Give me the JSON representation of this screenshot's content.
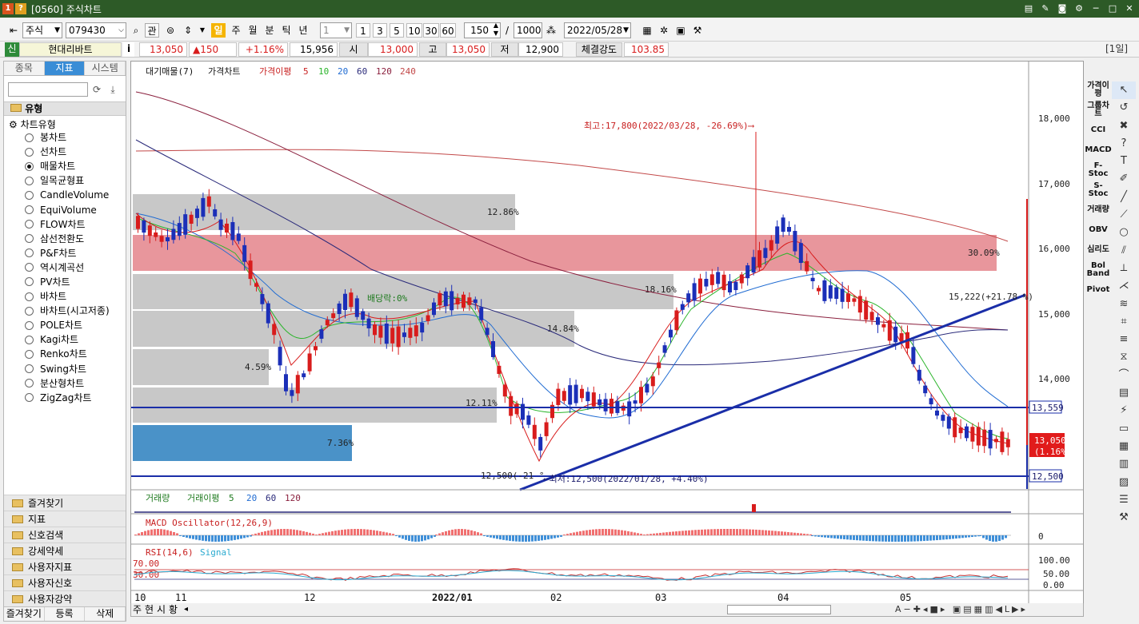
{
  "window": {
    "badge1": "1",
    "badge2": "?",
    "title": "[0560] 주식차트"
  },
  "titlebar_icons": [
    "doc-icon",
    "edit-icon",
    "camera-icon",
    "gear-icon",
    "minimize-icon",
    "maximize-icon",
    "close-icon"
  ],
  "toolbar": {
    "market": "주식",
    "code": "079430",
    "btn_gwan": "관",
    "periods": [
      "일",
      "주",
      "월",
      "분",
      "틱",
      "년"
    ],
    "interval": "1",
    "quick": [
      "1",
      "3",
      "5",
      "10",
      "30",
      "60"
    ],
    "count": "150",
    "slash": "/",
    "total": "1000",
    "date": "2022/05/28"
  },
  "quote": {
    "badge": "신",
    "name": "현대리바트",
    "info": "i",
    "price": "13,050",
    "change": "▲150",
    "change_pct": "+1.16%",
    "volume": "15,956",
    "open_label": "시",
    "open": "13,000",
    "high_label": "고",
    "high": "13,050",
    "low_label": "저",
    "low": "12,900",
    "strength_label": "체결강도",
    "strength": "103.85",
    "period_tag": "[1일]"
  },
  "left_panel": {
    "tabs": [
      "종목",
      "지표",
      "시스템"
    ],
    "active_tab": 1,
    "header": "유형",
    "tree_root": "차트유형",
    "chart_types": [
      "봉차트",
      "선차트",
      "매물차트",
      "일목균형표",
      "CandleVolume",
      "EquiVolume",
      "FLOW차트",
      "삼선전환도",
      "P&F차트",
      "역시계곡선",
      "PV차트",
      "바차트",
      "바차트(시고저종)",
      "POLE차트",
      "Kagi차트",
      "Renko차트",
      "Swing차트",
      "분산형차트",
      "ZigZag차트"
    ],
    "selected_index": 2,
    "groups": [
      "즐겨찾기",
      "지표",
      "신호검색",
      "강세약세",
      "사용자지표",
      "사용자신호",
      "사용자강약"
    ],
    "footer": [
      "즐겨찾기",
      "등록",
      "삭제"
    ]
  },
  "chart": {
    "legend_main": [
      "대기매물(7)",
      "가격차트",
      "가격이평",
      "5",
      "10",
      "20",
      "60",
      "120",
      "240"
    ],
    "legend_vol": [
      "거래량",
      "거래이평",
      "5",
      "20",
      "60",
      "120"
    ],
    "legend_macd": "MACD Oscillator(12,26,9)",
    "legend_rsi": [
      "RSI(14,6)",
      "Signal"
    ],
    "price_axis": [
      "18,000",
      "17,000",
      "16,000",
      "15,000",
      "14,000"
    ],
    "price_marks": {
      "line1": "13,559",
      "current": "13,050",
      "current_pct": "(1.16%)",
      "line2": "12,500"
    },
    "zones": [
      "12.86%",
      "30.09%",
      "18.16%",
      "14.84%",
      "4.59%",
      "12.11%",
      "7.36%"
    ],
    "annotations": {
      "high": "최고:17,800(2022/03/28, -26.69%)⟶",
      "low": "⟵최저:12,500(2022/01/28, +4.40%)",
      "low_left": "12,500(-21 °",
      "dividend": "배당락:0%",
      "trend": "15,222(+21.78 %)"
    },
    "macd_zero": "0",
    "rsi_levels": [
      "70.00",
      "30.00"
    ],
    "rsi_axis": [
      "100.00",
      "50.00",
      "0.00"
    ],
    "x_axis": [
      "10",
      "11",
      "12",
      "2022/01",
      "02",
      "03",
      "04",
      "05"
    ],
    "bottom_tabs": [
      "주",
      "현",
      "시",
      "황"
    ]
  },
  "right_indicators": [
    "가격이평",
    "그룹차트",
    "CCI",
    "MACD",
    "F-Stoc",
    "S-Stoc",
    "거래량",
    "OBV",
    "심리도",
    "Bol Band",
    "Pivot"
  ],
  "colors": {
    "up": "#d81c1c",
    "down": "#1b2fb8",
    "titlebar": "#2d5a27",
    "accent": "#3a8dd6",
    "zone_gray": "#c8c8c8",
    "zone_red": "#e8969c",
    "zone_blue": "#4a92c8"
  }
}
